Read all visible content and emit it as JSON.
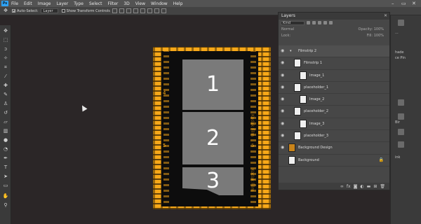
{
  "menu": {
    "logo": "Ps",
    "items": [
      "File",
      "Edit",
      "Image",
      "Layer",
      "Type",
      "Select",
      "Filter",
      "3D",
      "View",
      "Window",
      "Help"
    ]
  },
  "window_controls": {
    "minimize": "–",
    "maximize": "▭",
    "close": "✕"
  },
  "options_bar": {
    "auto_select_label": "Auto-Select:",
    "auto_select_value": "Layer",
    "transform_controls_label": "Show Transform Controls"
  },
  "tools": [
    "move-icon",
    "marquee-icon",
    "lasso-icon",
    "magic-wand-icon",
    "crop-icon",
    "eyedropper-icon",
    "healing-icon",
    "brush-icon",
    "stamp-icon",
    "history-brush-icon",
    "eraser-icon",
    "gradient-icon",
    "blur-icon",
    "dodge-icon",
    "pen-icon",
    "type-icon",
    "path-select-icon",
    "shape-icon",
    "hand-icon",
    "zoom-icon"
  ],
  "document": {
    "frames": [
      "1",
      "2",
      "3"
    ],
    "film_numbers": [
      "4",
      "5",
      "5"
    ],
    "film_labels": [
      "Kodak Film",
      "Kodak Film"
    ]
  },
  "layers_panel": {
    "title": "Layers",
    "close": "✕",
    "kind_label": "Kind",
    "blend_mode": "Normal",
    "opacity_label": "Opacity:",
    "opacity_value": "100%",
    "lock_label": "Lock:",
    "fill_label": "Fill:",
    "fill_value": "100%",
    "layers": [
      {
        "name": "Filmstrip 2",
        "type": "group"
      },
      {
        "name": "Filmstrip 1",
        "type": "layer"
      },
      {
        "name": "Image_1",
        "type": "layer"
      },
      {
        "name": "placeholder_1",
        "type": "layer"
      },
      {
        "name": "Image_2",
        "type": "layer"
      },
      {
        "name": "placeholder_2",
        "type": "layer"
      },
      {
        "name": "Image_3",
        "type": "layer"
      },
      {
        "name": "placeholder_3",
        "type": "layer"
      },
      {
        "name": "Background Design",
        "type": "layer"
      },
      {
        "name": "Background",
        "type": "background"
      }
    ],
    "footer_icons": [
      "link-icon",
      "fx-icon",
      "mask-icon",
      "adjustment-icon",
      "folder-icon",
      "new-layer-icon",
      "trash-icon"
    ]
  },
  "right_strip": {
    "labels": [
      "...",
      "hade",
      "ce Pin",
      "Bir",
      "ink"
    ]
  },
  "colors": {
    "document_orange": "#f7a819",
    "frame_gray": "#7a7a7a",
    "canvas_bg": "#2b2627"
  }
}
